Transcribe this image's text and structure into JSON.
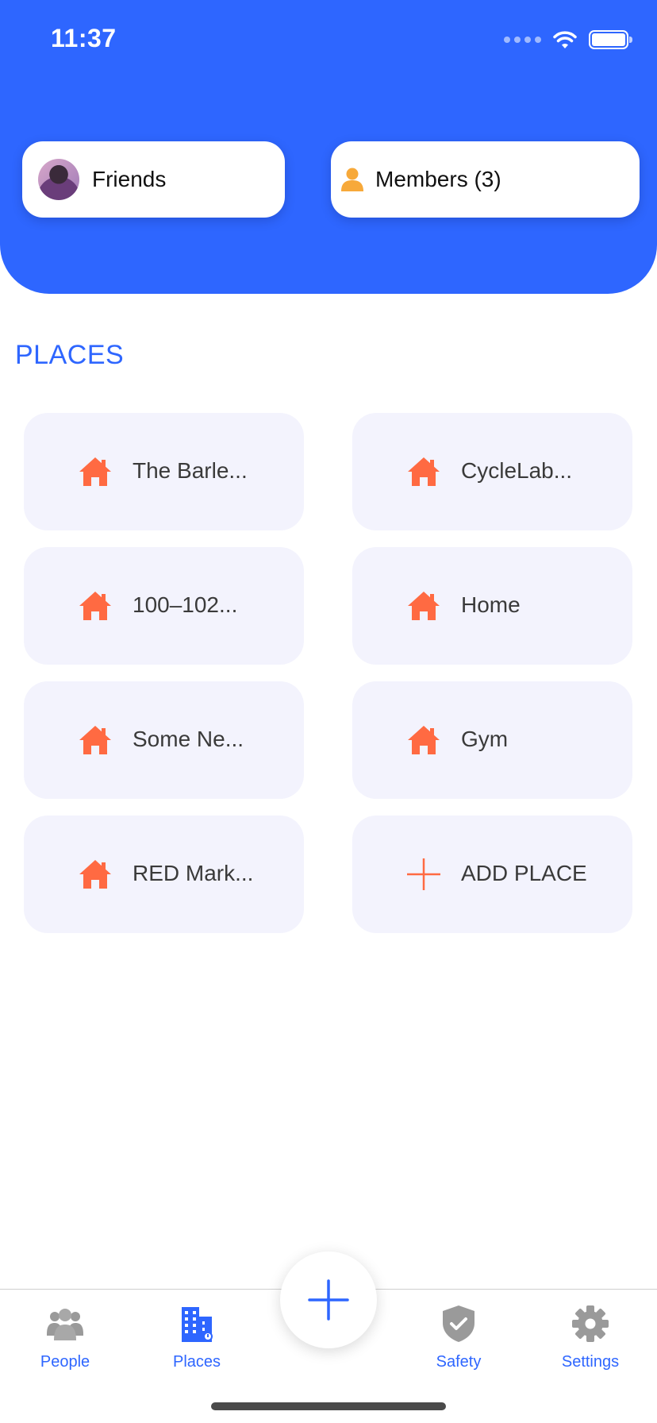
{
  "status_bar": {
    "time": "11:37"
  },
  "header": {
    "friends_label": "Friends",
    "members_label": "Members (3)"
  },
  "section_title": "PLACES",
  "places": [
    {
      "label": "The Barle...",
      "icon": "home-icon"
    },
    {
      "label": "CycleLab...",
      "icon": "home-icon"
    },
    {
      "label": "100–102...",
      "icon": "home-icon"
    },
    {
      "label": "Home",
      "icon": "home-icon"
    },
    {
      "label": "Some Ne...",
      "icon": "home-icon"
    },
    {
      "label": "Gym",
      "icon": "home-icon"
    },
    {
      "label": "RED Mark...",
      "icon": "home-icon"
    }
  ],
  "add_place_label": "ADD PLACE",
  "tabs": [
    {
      "label": "People",
      "icon": "people-icon"
    },
    {
      "label": "Places",
      "icon": "building-icon",
      "active": true
    },
    {
      "label": "Safety",
      "icon": "shield-icon"
    },
    {
      "label": "Settings",
      "icon": "gear-icon"
    }
  ],
  "colors": {
    "primary": "#2e66ff",
    "accent": "#ff6a42",
    "card_bg": "#f3f3fd",
    "member_icon": "#f7a93a",
    "inactive_icon": "#9a9a9a"
  }
}
